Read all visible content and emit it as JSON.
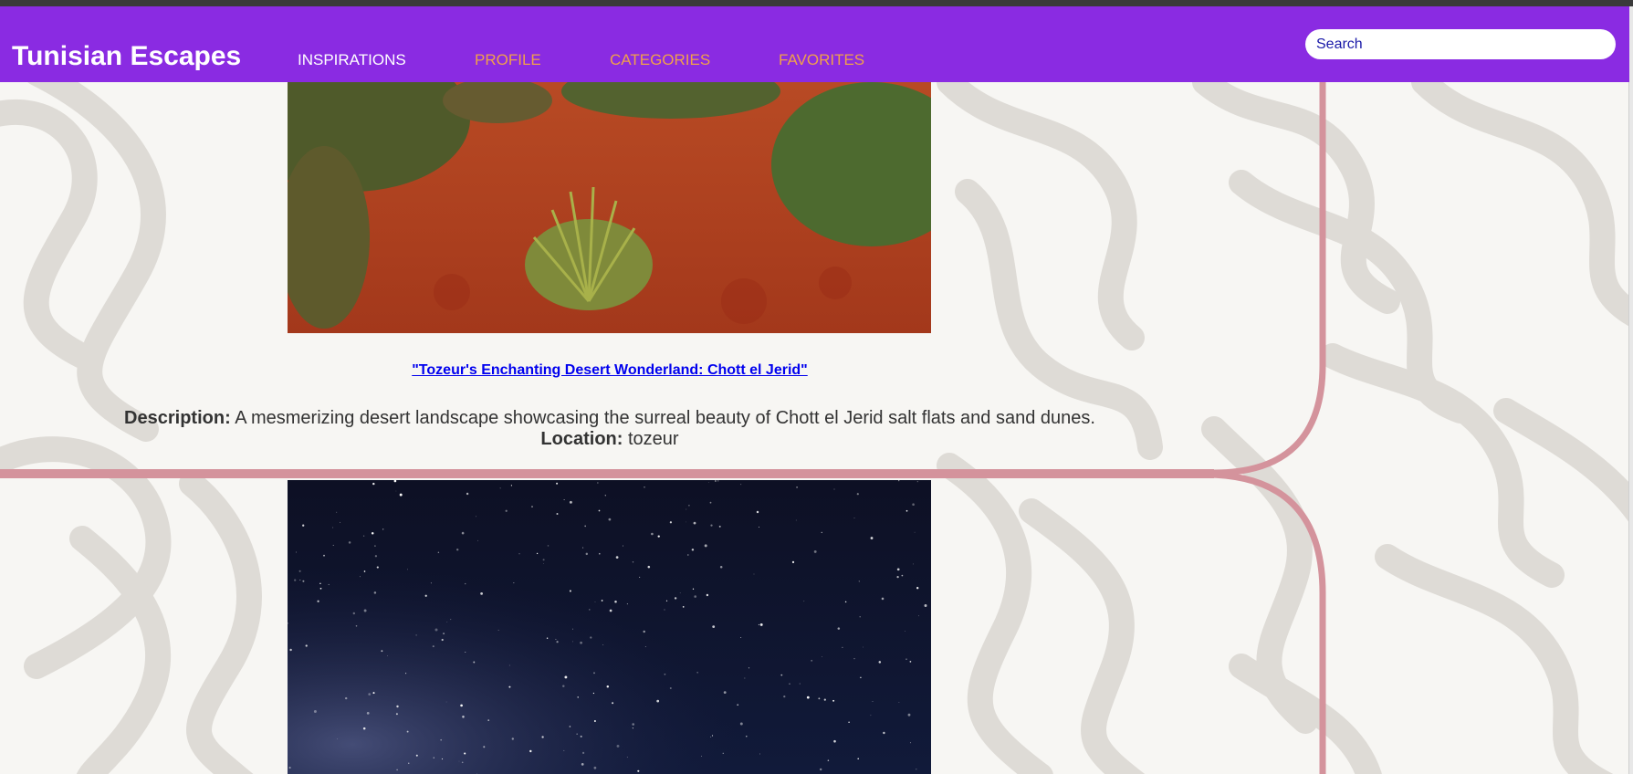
{
  "brand": {
    "name": "Tunisian Escapes"
  },
  "nav": {
    "inspirations": "INSPIRATIONS",
    "profile": "PROFILE",
    "categories": "CATEGORIES",
    "favorites": "FAVORITES"
  },
  "search": {
    "placeholder": "Search"
  },
  "cards": [
    {
      "image_subject": "red desert sand with grass shrubs",
      "title": "\"Tozeur's Enchanting Desert Wonderland: Chott el Jerid\"",
      "description_label": "Description:",
      "description": "A mesmerizing desert landscape showcasing the surreal beauty of Chott el Jerid salt flats and sand dunes.",
      "location_label": "Location:",
      "location": "tozeur"
    },
    {
      "image_subject": "starry night sky with milky way"
    }
  ],
  "colors": {
    "navbar": "#8a2be2",
    "brand_text": "#ffffff",
    "nav_active": "#ffffff",
    "nav_inactive": "#f0a04b",
    "link": "#0000ee",
    "divider": "#d4939c",
    "pattern": "#dedbd6"
  }
}
